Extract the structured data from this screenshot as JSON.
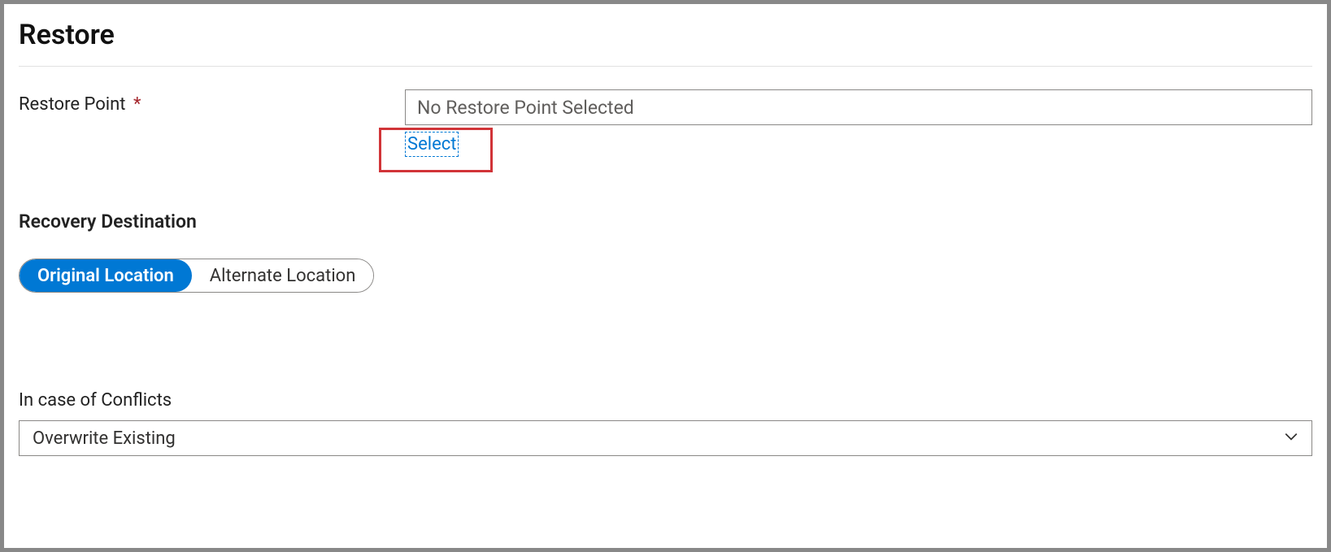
{
  "header": {
    "title": "Restore"
  },
  "restorePoint": {
    "label": "Restore Point",
    "required": "*",
    "placeholder": "No Restore Point Selected",
    "selectLink": "Select"
  },
  "recoveryDestination": {
    "label": "Recovery Destination",
    "options": {
      "original": "Original Location",
      "alternate": "Alternate Location"
    }
  },
  "conflicts": {
    "label": "In case of Conflicts",
    "selected": "Overwrite Existing"
  }
}
